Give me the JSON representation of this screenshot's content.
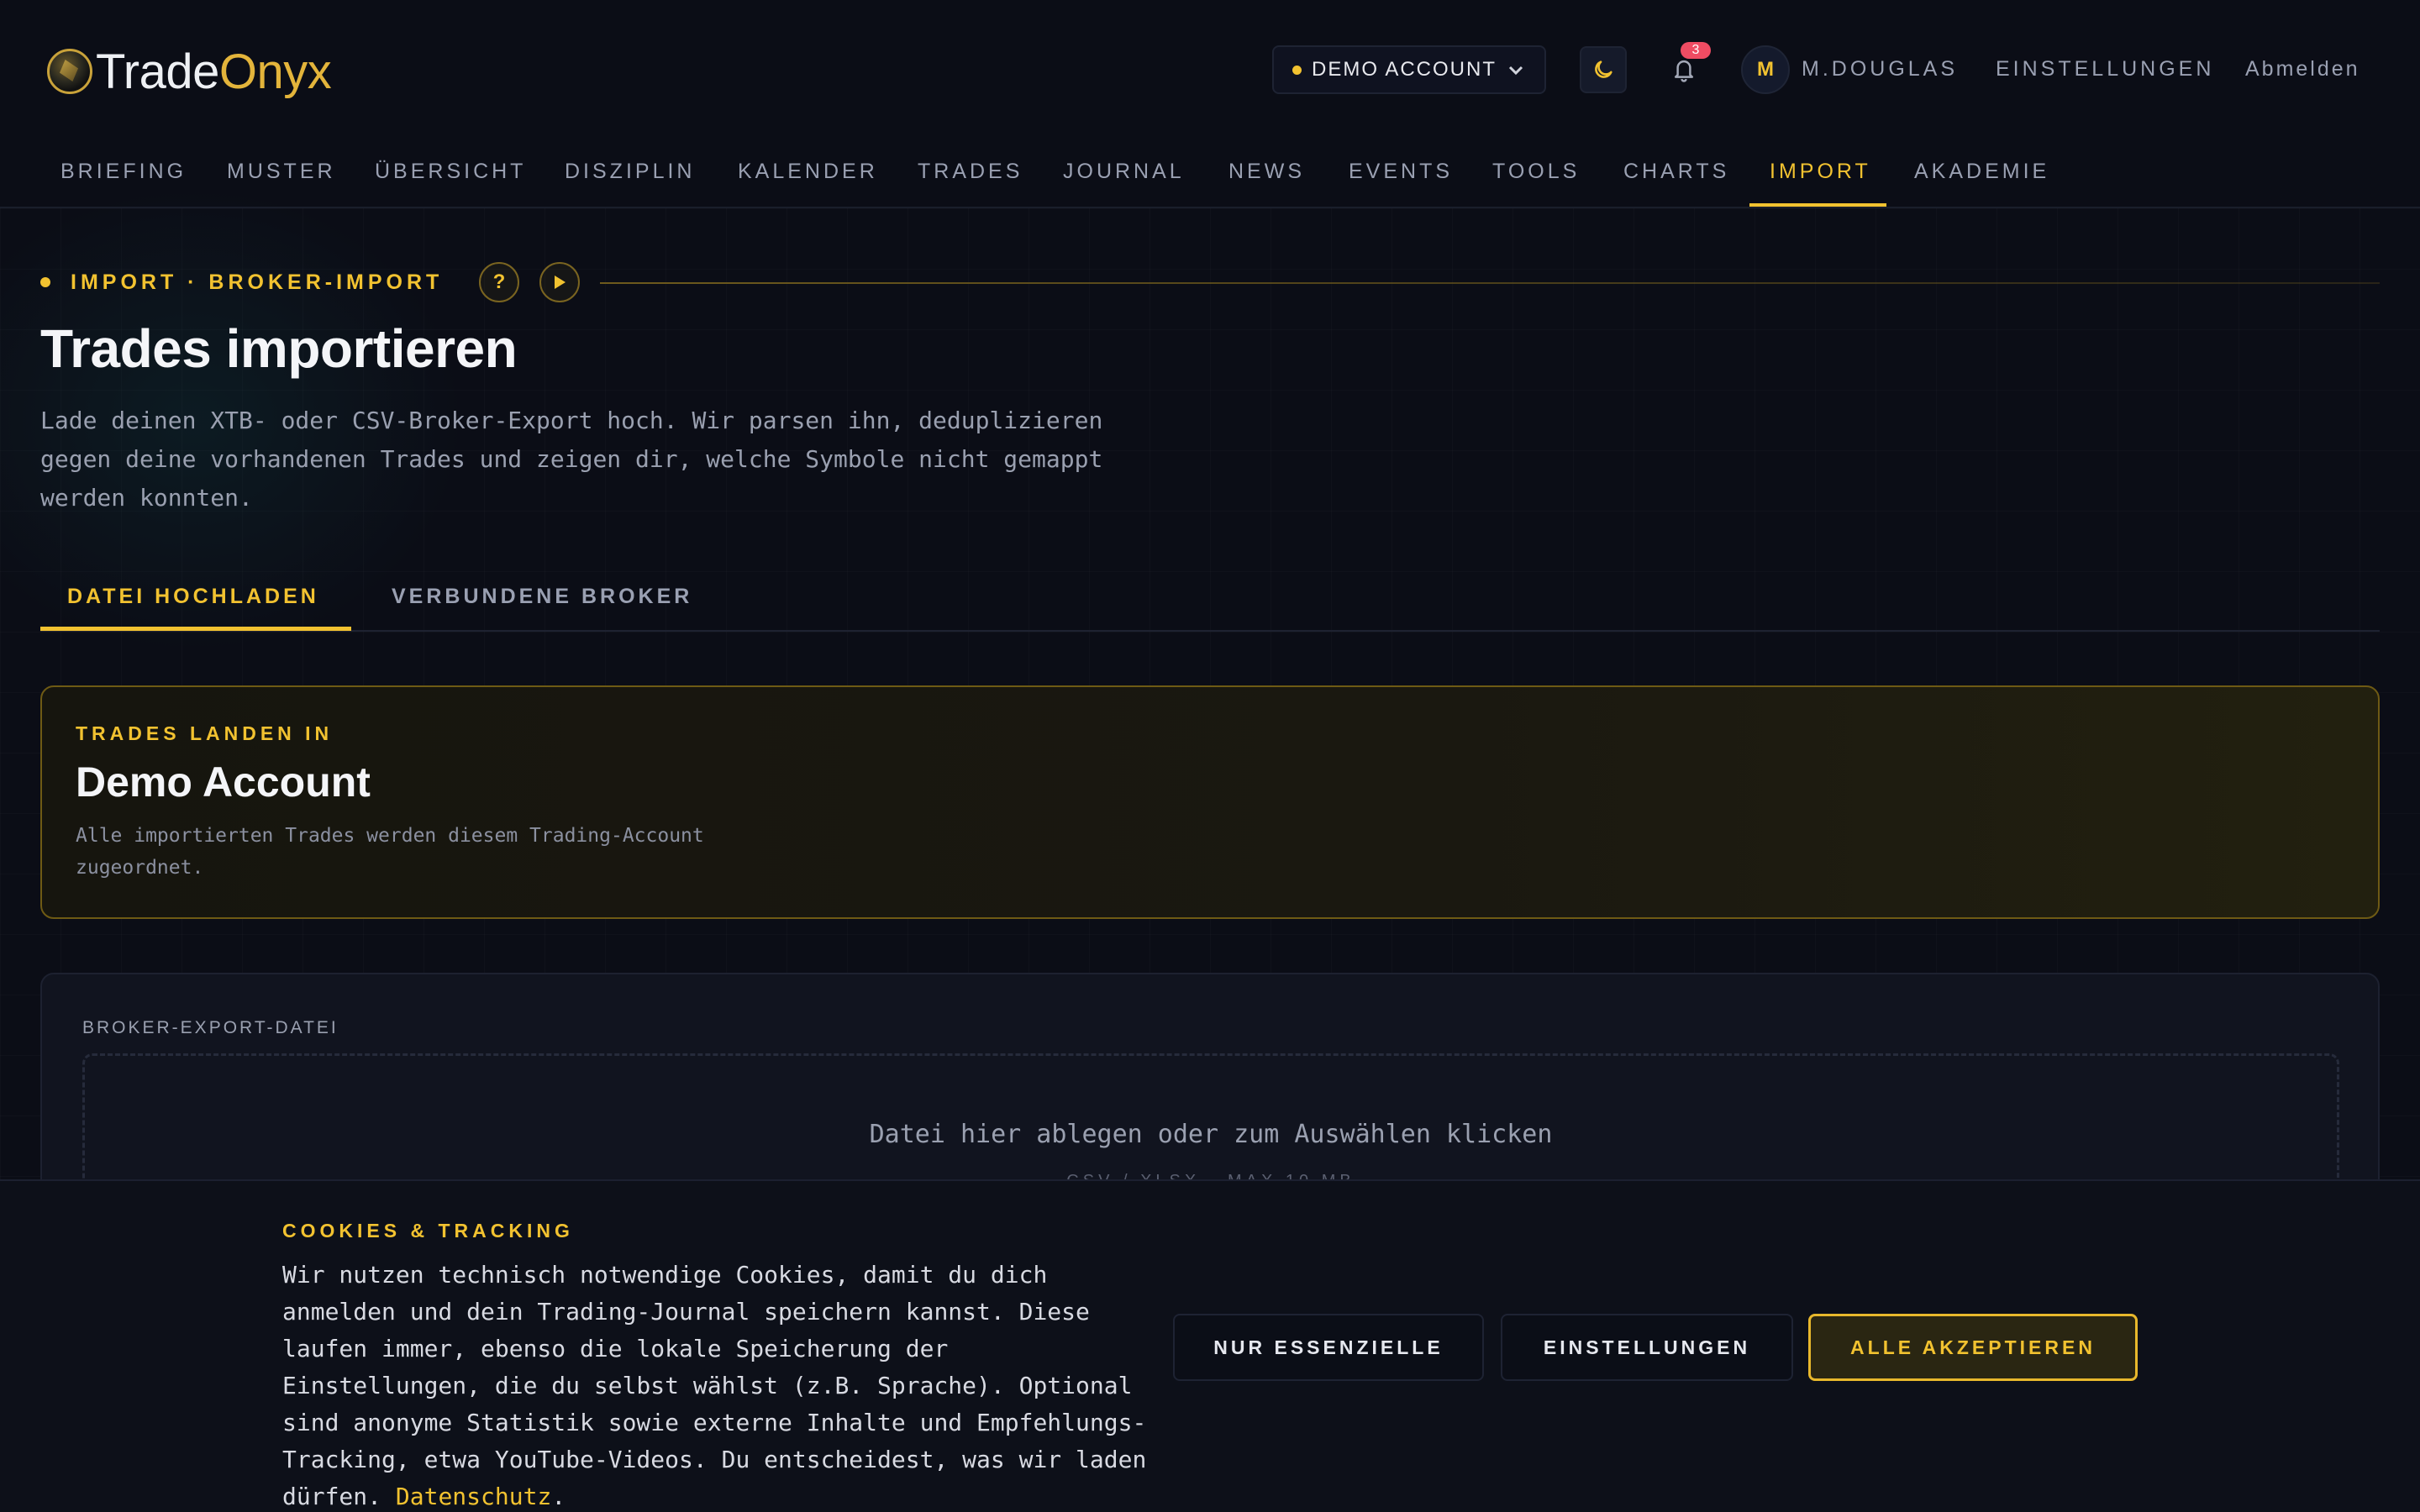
{
  "brand": {
    "name_part1": "Trade",
    "name_part2": "Onyx",
    "accent_color": "#e3b43b"
  },
  "header": {
    "account_label": "DEMO ACCOUNT",
    "notification_count": "3",
    "avatar_initial": "M",
    "user_name": "M.DOUGLAS",
    "settings_label": "EINSTELLUNGEN",
    "logout_label": "Abmelden"
  },
  "nav": {
    "items": [
      "BRIEFING",
      "MUSTER",
      "ÜBERSICHT",
      "DISZIPLIN",
      "KALENDER",
      "TRADES",
      "JOURNAL",
      "NEWS",
      "EVENTS",
      "TOOLS",
      "CHARTS",
      "IMPORT",
      "AKADEMIE"
    ],
    "active": "IMPORT"
  },
  "page": {
    "eyebrow": "IMPORT · BROKER-IMPORT",
    "help_glyph": "?",
    "title": "Trades importieren",
    "description": "Lade deinen XTB- oder CSV-Broker-Export hoch. Wir parsen ihn, deduplizieren gegen deine vorhandenen Trades und zeigen dir, welche Symbole nicht gemappt werden konnten."
  },
  "tabs": [
    "DATEI HOCHLADEN",
    "VERBUNDENE BROKER"
  ],
  "target": {
    "label": "TRADES LANDEN IN",
    "account_name": "Demo Account",
    "note": "Alle importierten Trades werden diesem Trading-Account zugeordnet."
  },
  "upload": {
    "label": "BROKER-EXPORT-DATEI",
    "dropzone_text": "Datei hier ablegen oder zum Auswählen klicken",
    "dropzone_hint": "CSV / XLSX · MAX 10 MB"
  },
  "cookie": {
    "title": "COOKIES & TRACKING",
    "text": "Wir nutzen technisch notwendige Cookies, damit du dich anmelden und dein Trading-Journal speichern kannst. Diese laufen immer, ebenso die lokale Speicherung der Einstellungen, die du selbst wählst (z.B. Sprache). Optional sind anonyme Statistik sowie externe Inhalte und Empfehlungs-Tracking, etwa YouTube-Videos. Du entscheidest, was wir laden dürfen.",
    "link_text": "Datenschutz",
    "period": ".",
    "btn_essential": "NUR ESSENZIELLE",
    "btn_settings": "EINSTELLUNGEN",
    "btn_accept_all": "ALLE AKZEPTIEREN"
  },
  "icons": {
    "moon": "moon-icon",
    "bell": "bell-icon",
    "chevron": "chevron-down-icon",
    "play": "play-icon",
    "help": "help-icon"
  }
}
